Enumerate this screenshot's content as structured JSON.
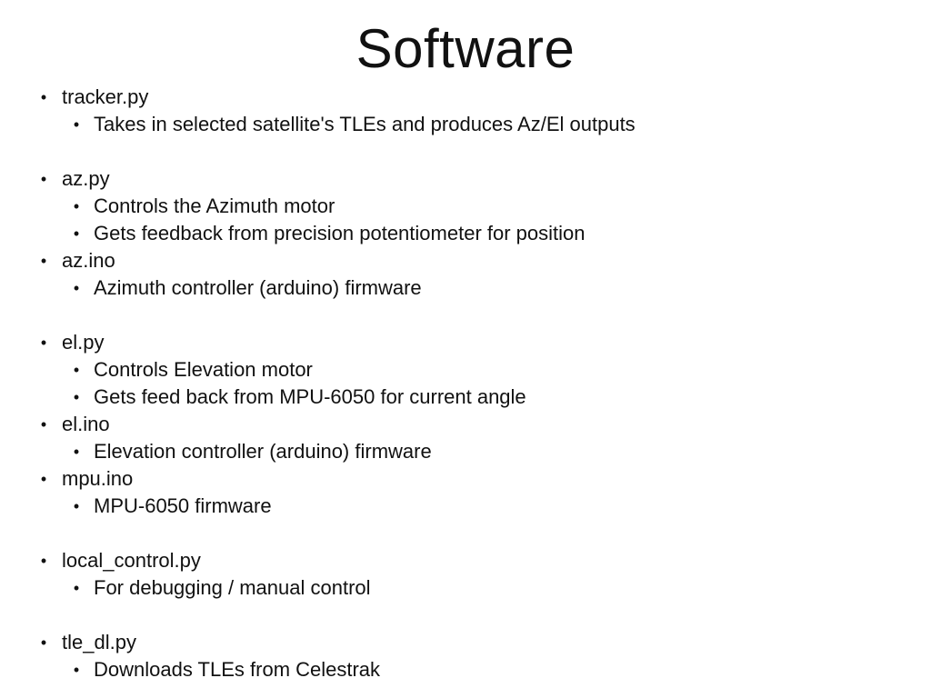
{
  "slide": {
    "title": "Software",
    "bullet_glyph": "•",
    "items": [
      {
        "level": 1,
        "text": "tracker.py"
      },
      {
        "level": 2,
        "text": "Takes in selected satellite's TLEs and produces Az/El outputs"
      },
      {
        "level": 0,
        "text": ""
      },
      {
        "level": 1,
        "text": "az.py"
      },
      {
        "level": 2,
        "text": "Controls the Azimuth motor"
      },
      {
        "level": 2,
        "text": "Gets feedback from precision potentiometer for position"
      },
      {
        "level": 1,
        "text": "az.ino"
      },
      {
        "level": 2,
        "text": "Azimuth controller (arduino) firmware"
      },
      {
        "level": 0,
        "text": ""
      },
      {
        "level": 1,
        "text": "el.py"
      },
      {
        "level": 2,
        "text": "Controls Elevation motor"
      },
      {
        "level": 2,
        "text": "Gets feed back from MPU-6050 for current angle"
      },
      {
        "level": 1,
        "text": "el.ino"
      },
      {
        "level": 2,
        "text": "Elevation controller (arduino) firmware"
      },
      {
        "level": 1,
        "text": "mpu.ino"
      },
      {
        "level": 2,
        "text": "MPU-6050 firmware"
      },
      {
        "level": 0,
        "text": ""
      },
      {
        "level": 1,
        "text": "local_control.py"
      },
      {
        "level": 2,
        "text": "For debugging / manual control"
      },
      {
        "level": 0,
        "text": ""
      },
      {
        "level": 1,
        "text": "tle_dl.py"
      },
      {
        "level": 2,
        "text": "Downloads TLEs from Celestrak"
      }
    ]
  }
}
